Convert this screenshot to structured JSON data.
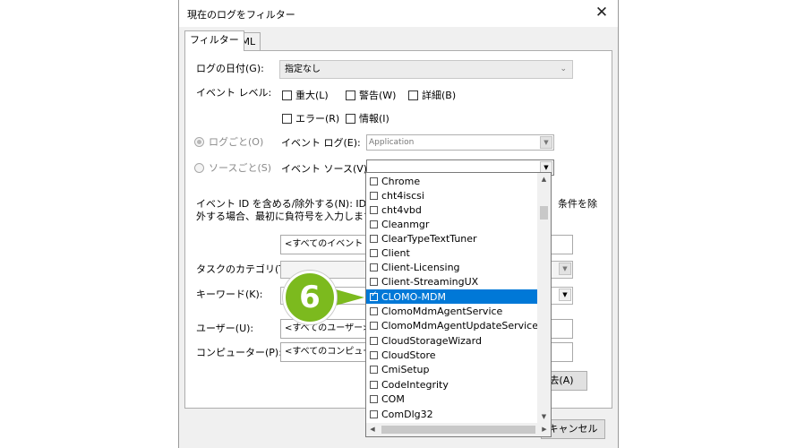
{
  "dialog": {
    "title": "現在のログをフィルター",
    "close_icon": "close-icon"
  },
  "tabs": [
    {
      "label": "フィルター",
      "active": true
    },
    {
      "label": "XML",
      "active": false
    }
  ],
  "filter": {
    "date_label": "ログの日付(G):",
    "date_value": "指定なし",
    "event_level_label": "イベント レベル:",
    "levels": [
      "重大(L)",
      "警告(W)",
      "詳細(B)",
      "エラー(R)",
      "情報(I)"
    ],
    "by_log_label": "ログごと(O)",
    "by_source_label": "ソースごと(S)",
    "event_log_label": "イベント ログ(E):",
    "event_log_value": "Application",
    "event_source_label": "イベント ソース(V):",
    "event_source_value": "",
    "event_id_text_1": "イベント ID を含める/除外する(N): ID 番",
    "event_id_text_2": "外する場合、最初に負符号を入力します。例",
    "event_id_text_3": "条件を除",
    "event_id_placeholder": "<すべてのイベント ID",
    "task_category_label": "タスクのカテゴリ(T):",
    "keywords_label": "キーワード(K):",
    "user_label": "ユーザー(U):",
    "user_value": "<すべてのユーザー>",
    "computer_label": "コンピューター(P):",
    "computer_value": "<すべてのコンピュータ",
    "clear_button": "去(A)",
    "cancel_button": "キャンセル"
  },
  "source_list": [
    {
      "label": "Chrome",
      "checked": false
    },
    {
      "label": "cht4iscsi",
      "checked": false
    },
    {
      "label": "cht4vbd",
      "checked": false
    },
    {
      "label": "Cleanmgr",
      "checked": false
    },
    {
      "label": "ClearTypeTextTuner",
      "checked": false
    },
    {
      "label": "Client",
      "checked": false
    },
    {
      "label": "Client-Licensing",
      "checked": false
    },
    {
      "label": "Client-StreamingUX",
      "checked": false
    },
    {
      "label": "CLOMO-MDM",
      "checked": true,
      "selected": true
    },
    {
      "label": "ClomoMdmAgentService",
      "checked": false
    },
    {
      "label": "ClomoMdmAgentUpdateService",
      "checked": false
    },
    {
      "label": "CloudStorageWizard",
      "checked": false
    },
    {
      "label": "CloudStore",
      "checked": false
    },
    {
      "label": "CmiSetup",
      "checked": false
    },
    {
      "label": "CodeIntegrity",
      "checked": false
    },
    {
      "label": "COM",
      "checked": false
    },
    {
      "label": "ComDlg32",
      "checked": false
    }
  ],
  "callout": {
    "number": "6",
    "color": "#7cba1e"
  },
  "colors": {
    "selection": "#0078d7",
    "dialog_bg": "#f0f0f0"
  }
}
